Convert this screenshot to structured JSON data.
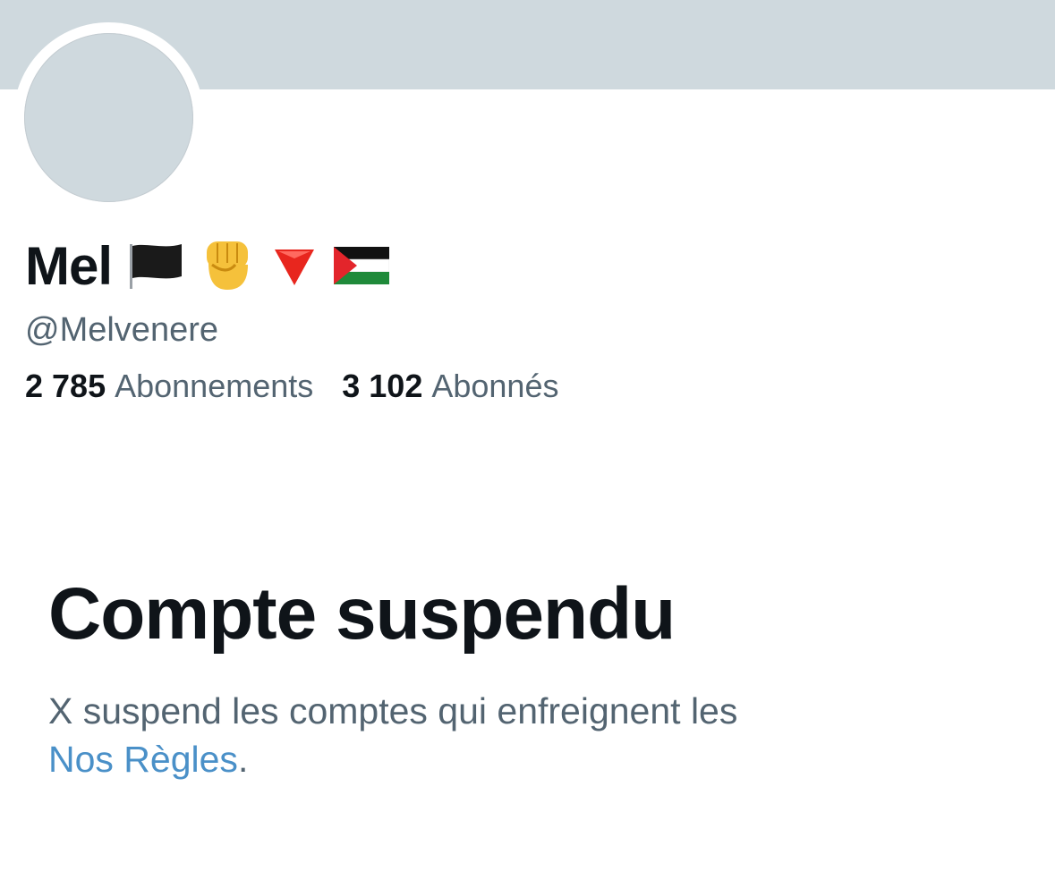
{
  "profile": {
    "display_name": "Mel",
    "emojis": [
      "black-flag-icon",
      "raised-fist-icon",
      "red-down-triangle-icon",
      "palestine-flag-icon"
    ],
    "handle": "@Melvenere",
    "following_count": "2 785",
    "following_label": "Abonnements",
    "followers_count": "3 102",
    "followers_label": "Abonnés"
  },
  "suspension": {
    "title": "Compte suspendu",
    "text": "X suspend les comptes qui enfreignent les",
    "link_label": "Nos Règles",
    "trailing": "."
  },
  "colors": {
    "banner": "#cfd9de",
    "avatar": "#cfd9de",
    "primary_text": "#0f1419",
    "secondary_text": "#536471",
    "link": "#4a90c8"
  }
}
